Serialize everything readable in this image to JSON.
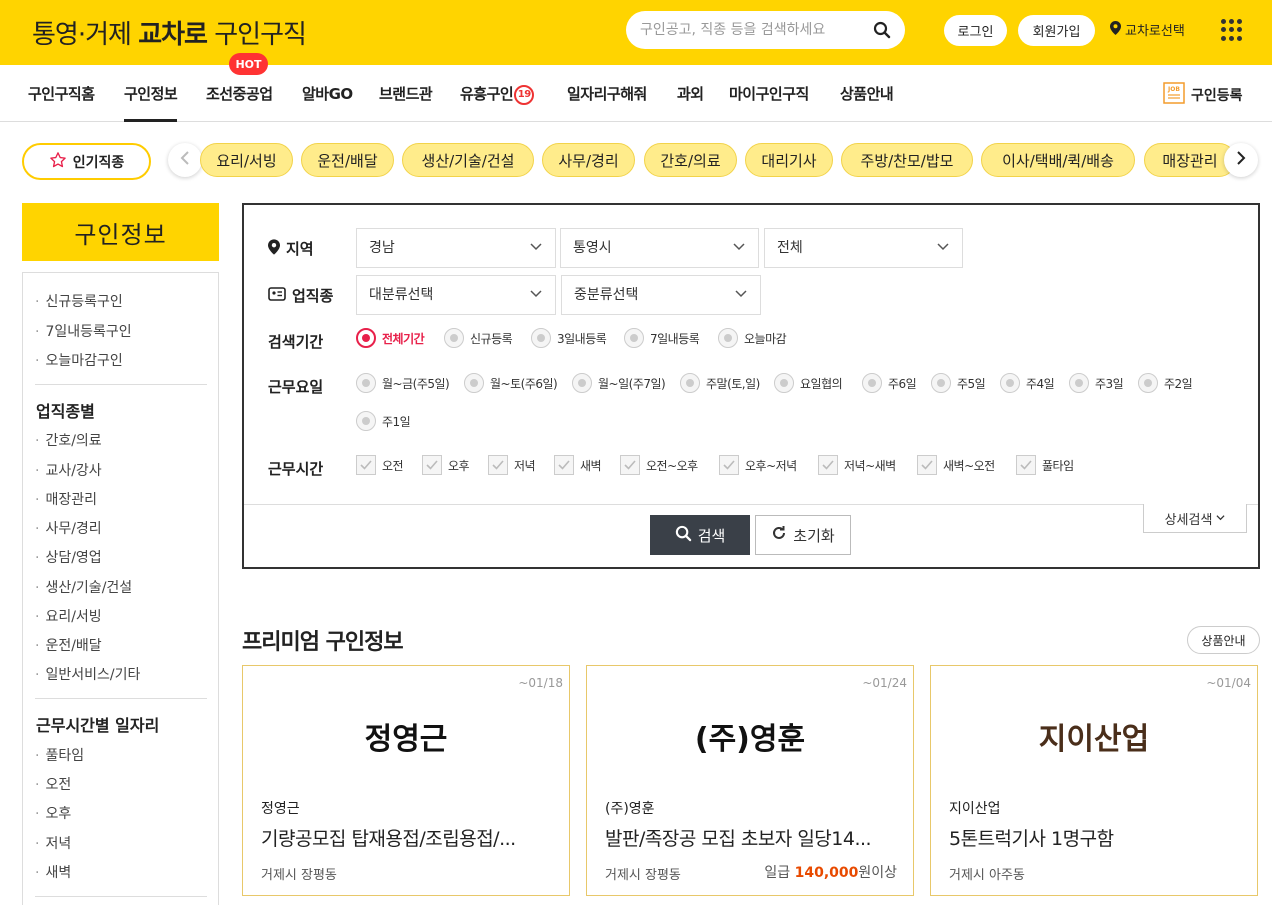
{
  "header": {
    "logo_region": "통영·거제",
    "logo_brand": "교차로",
    "logo_suffix": "구인구직",
    "search_placeholder": "구인공고, 직종 등을 검색하세요",
    "login": "로그인",
    "signup": "회원가입",
    "region_select": "교차로선택",
    "brand_color": "#ffd400"
  },
  "nav": {
    "items": [
      "구인구직홈",
      "구인정보",
      "조선중공업",
      "알바GO",
      "브랜드관",
      "유흥구인",
      "일자리구해줘",
      "과외",
      "마이구인구직",
      "상품안내"
    ],
    "active": "구인정보",
    "hot_badge": "HOT",
    "age_badge": "19",
    "register": "구인등록",
    "register_icon_text": "JOB"
  },
  "popular": {
    "label": "인기직종",
    "chips": [
      "요리/서빙",
      "운전/배달",
      "생산/기술/건설",
      "사무/경리",
      "간호/의료",
      "대리기사",
      "주방/찬모/밥모",
      "이사/택배/퀵/배송",
      "매장관리"
    ]
  },
  "sidebar": {
    "title": "구인정보",
    "group1": [
      "신규등록구인",
      "7일내등록구인",
      "오늘마감구인"
    ],
    "group2_title": "업직종별",
    "group2": [
      "간호/의료",
      "교사/강사",
      "매장관리",
      "사무/경리",
      "상담/영업",
      "생산/기술/건설",
      "요리/서빙",
      "운전/배달",
      "일반서비스/기타"
    ],
    "group3_title": "근무시간별 일자리",
    "group3": [
      "풀타임",
      "오전",
      "오후",
      "저녁",
      "새벽"
    ]
  },
  "search": {
    "region_label": "지역",
    "region_values": [
      "경남",
      "통영시",
      "전체"
    ],
    "job_label": "업직종",
    "job_values": [
      "대분류선택",
      "중분류선택"
    ],
    "period_label": "검색기간",
    "period_options": [
      "전체기간",
      "신규등록",
      "3일내등록",
      "7일내등록",
      "오늘마감"
    ],
    "period_selected": "전체기간",
    "days_label": "근무요일",
    "days_options": [
      "월~금(주5일)",
      "월~토(주6일)",
      "월~일(주7일)",
      "주말(토,일)",
      "요일협의",
      "주6일",
      "주5일",
      "주4일",
      "주3일",
      "주2일",
      "주1일"
    ],
    "time_label": "근무시간",
    "time_options": [
      "오전",
      "오후",
      "저녁",
      "새벽",
      "오전~오후",
      "오후~저녁",
      "저녁~새벽",
      "새벽~오전",
      "풀타임"
    ],
    "search_btn": "검색",
    "reset_btn": "초기화",
    "detail_btn": "상세검색",
    "accent_color": "#e8204a"
  },
  "premium": {
    "title": "프리미엄 구인정보",
    "guide": "상품안내",
    "cards": [
      {
        "date": "~01/18",
        "logo": "정영근",
        "company": "정영근",
        "title": "기량공모집 탑재용접/조립용접/...",
        "location": "거제시 장평동",
        "pay_prefix": "",
        "pay_amount": "",
        "pay_suffix": ""
      },
      {
        "date": "~01/24",
        "logo": "(주)영훈",
        "company": "(주)영훈",
        "title": "발판/족장공 모집 초보자 일당14...",
        "location": "거제시 장평동",
        "pay_prefix": "일급 ",
        "pay_amount": "140,000",
        "pay_suffix": "원이상"
      },
      {
        "date": "~01/04",
        "logo": "지이산업",
        "company": "지이산업",
        "title": "5톤트럭기사 1명구함",
        "location": "거제시 아주동",
        "pay_prefix": "",
        "pay_amount": "",
        "pay_suffix": ""
      }
    ]
  }
}
